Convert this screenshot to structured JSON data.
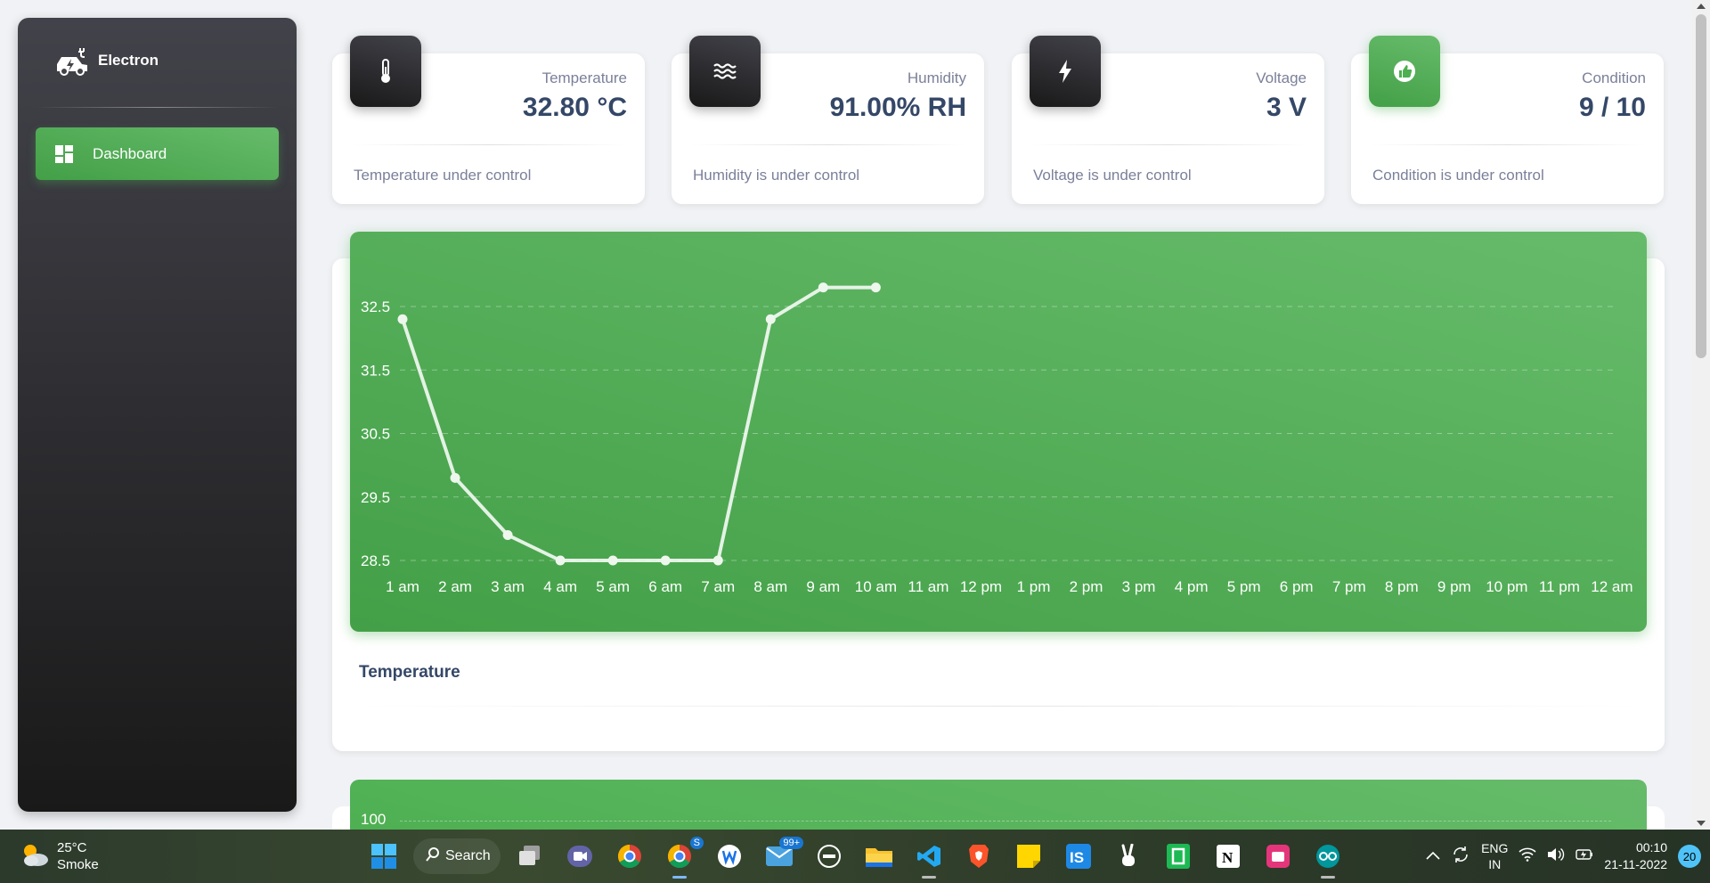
{
  "sidebar": {
    "brand": "Electron",
    "nav": [
      {
        "label": "Dashboard",
        "active": true
      }
    ]
  },
  "cards": [
    {
      "label": "Temperature",
      "value": "32.80 °C",
      "footer": "Temperature under control",
      "icon": "thermometer-icon"
    },
    {
      "label": "Humidity",
      "value": "91.00% RH",
      "footer": "Humidity is under control",
      "icon": "waves-icon"
    },
    {
      "label": "Voltage",
      "value": "3 V",
      "footer": "Voltage is under control",
      "icon": "bolt-icon"
    },
    {
      "label": "Condition",
      "value": "9 / 10",
      "footer": "Condition is under control",
      "icon": "thumb-up-icon"
    }
  ],
  "chart": {
    "title": "Temperature"
  },
  "chart_data": {
    "type": "line",
    "categories": [
      "1 am",
      "2 am",
      "3 am",
      "4 am",
      "5 am",
      "6 am",
      "7 am",
      "8 am",
      "9 am",
      "10 am",
      "11 am",
      "12 pm",
      "1 pm",
      "2 pm",
      "3 pm",
      "4 pm",
      "5 pm",
      "6 pm",
      "7 pm",
      "8 pm",
      "9 pm",
      "10 pm",
      "11 pm",
      "12 am"
    ],
    "series": [
      {
        "values": [
          32.3,
          29.8,
          28.9,
          28.5,
          28.5,
          28.5,
          28.5,
          32.3,
          32.8,
          32.8
        ]
      }
    ],
    "yticks": [
      "28.5",
      "29.5",
      "30.5",
      "31.5",
      "32.5"
    ],
    "ylim": [
      28.5,
      32.5
    ],
    "grid": true,
    "colors": {
      "line": "#ffffff",
      "background": "#4caf50"
    }
  },
  "chart2": {
    "first_tick": "100"
  },
  "taskbar": {
    "weather_temp": "25°C",
    "weather_desc": "Smoke",
    "search_label": "Search",
    "mail_badge": "99+",
    "chrome_badge": "S",
    "lang_top": "ENG",
    "lang_bottom": "IN",
    "time": "00:10",
    "date": "21-11-2022",
    "notifications": "20"
  }
}
